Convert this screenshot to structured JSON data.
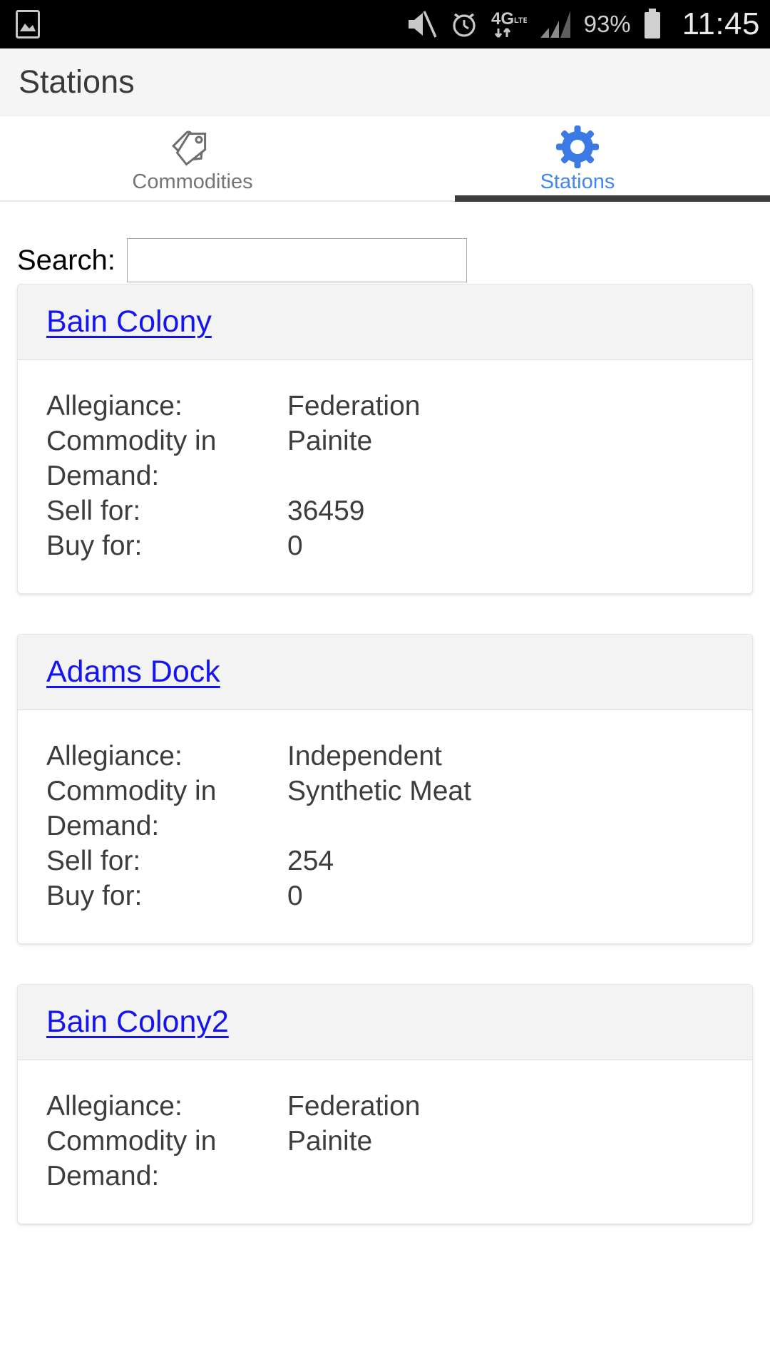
{
  "status_bar": {
    "icons_left": [
      "image-icon"
    ],
    "icons_right": [
      "volume-mute-icon",
      "alarm-clock-icon",
      "network-4g-lte-icon",
      "signal-bars-icon",
      "battery-icon"
    ],
    "battery_percent": "93%",
    "clock": "11:45"
  },
  "app_bar": {
    "title": "Stations"
  },
  "tabs": [
    {
      "label": "Commodities",
      "icon": "tag-icon",
      "active": false
    },
    {
      "label": "Stations",
      "icon": "gear-icon",
      "active": true
    }
  ],
  "search": {
    "label": "Search:",
    "value": "",
    "placeholder": ""
  },
  "colors": {
    "accent": "#4285f4",
    "link": "#1414ef",
    "indicator": "#3c3c3c",
    "header_bg": "#f5f5f5",
    "card_header_bg": "#f3f3f3",
    "text": "#3d3d3d"
  },
  "field_labels": {
    "allegiance": "Allegiance:",
    "commodity_in_demand": "Commodity in Demand:",
    "sell_for": "Sell for:",
    "buy_for": "Buy for:"
  },
  "stations": [
    {
      "name": "Bain Colony",
      "allegiance": "Federation",
      "commodity_in_demand": "Painite",
      "sell_for": "36459",
      "buy_for": "0"
    },
    {
      "name": "Adams Dock",
      "allegiance": "Independent",
      "commodity_in_demand": "Synthetic Meat",
      "sell_for": "254",
      "buy_for": "0"
    },
    {
      "name": "Bain Colony2",
      "allegiance": "Federation",
      "commodity_in_demand": "Painite",
      "sell_for": "",
      "buy_for": ""
    }
  ]
}
